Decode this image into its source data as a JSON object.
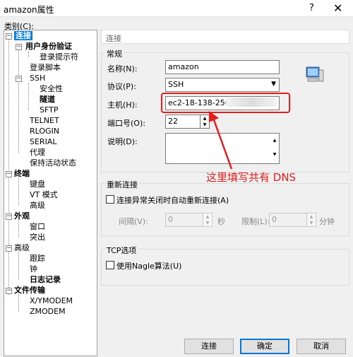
{
  "window": {
    "title": "amazon属性",
    "help": "?",
    "close": "✕"
  },
  "category_label": "类别(C):",
  "tree": {
    "items": [
      {
        "label": "连接"
      },
      {
        "label": "用户身份验证"
      },
      {
        "label": "登录提示符"
      },
      {
        "label": "登录脚本"
      },
      {
        "label": "SSH"
      },
      {
        "label": "安全性"
      },
      {
        "label": "隧道"
      },
      {
        "label": "SFTP"
      },
      {
        "label": "TELNET"
      },
      {
        "label": "RLOGIN"
      },
      {
        "label": "SERIAL"
      },
      {
        "label": "代理"
      },
      {
        "label": "保持活动状态"
      },
      {
        "label": "终端"
      },
      {
        "label": "键盘"
      },
      {
        "label": "VT 模式"
      },
      {
        "label": "高级"
      },
      {
        "label": "外观"
      },
      {
        "label": "窗口"
      },
      {
        "label": "突出"
      },
      {
        "label": "高级"
      },
      {
        "label": "跟踪"
      },
      {
        "label": "钟"
      },
      {
        "label": "日志记录"
      },
      {
        "label": "文件传输"
      },
      {
        "label": "X/YMODEM"
      },
      {
        "label": "ZMODEM"
      }
    ]
  },
  "section_header": "连接",
  "general": {
    "title": "常规",
    "name_label": "名称(N):",
    "name_value": "amazon",
    "protocol_label": "协议(P):",
    "protocol_value": "SSH",
    "host_label": "主机(H):",
    "host_value": "ec2-18-138-250-63.a",
    "port_label": "端口号(O):",
    "port_value": "22",
    "desc_label": "说明(D):"
  },
  "reconnect": {
    "title": "重新连接",
    "checkbox_label": "连接异常关闭时自动重新连接(A)",
    "interval_label": "间隔(V):",
    "interval_value": "0",
    "interval_unit": "秒",
    "limit_label": "限制(L):",
    "limit_value": "0",
    "limit_unit": "分钟"
  },
  "tcp": {
    "title": "TCP选项",
    "nagle_label": "使用Nagle算法(U)"
  },
  "annotation": "这里填写共有 DNS",
  "buttons": {
    "connect": "连接",
    "ok": "确定",
    "cancel": "取消"
  },
  "colors": {
    "accent": "#0078d7",
    "annotation": "#e02020"
  }
}
